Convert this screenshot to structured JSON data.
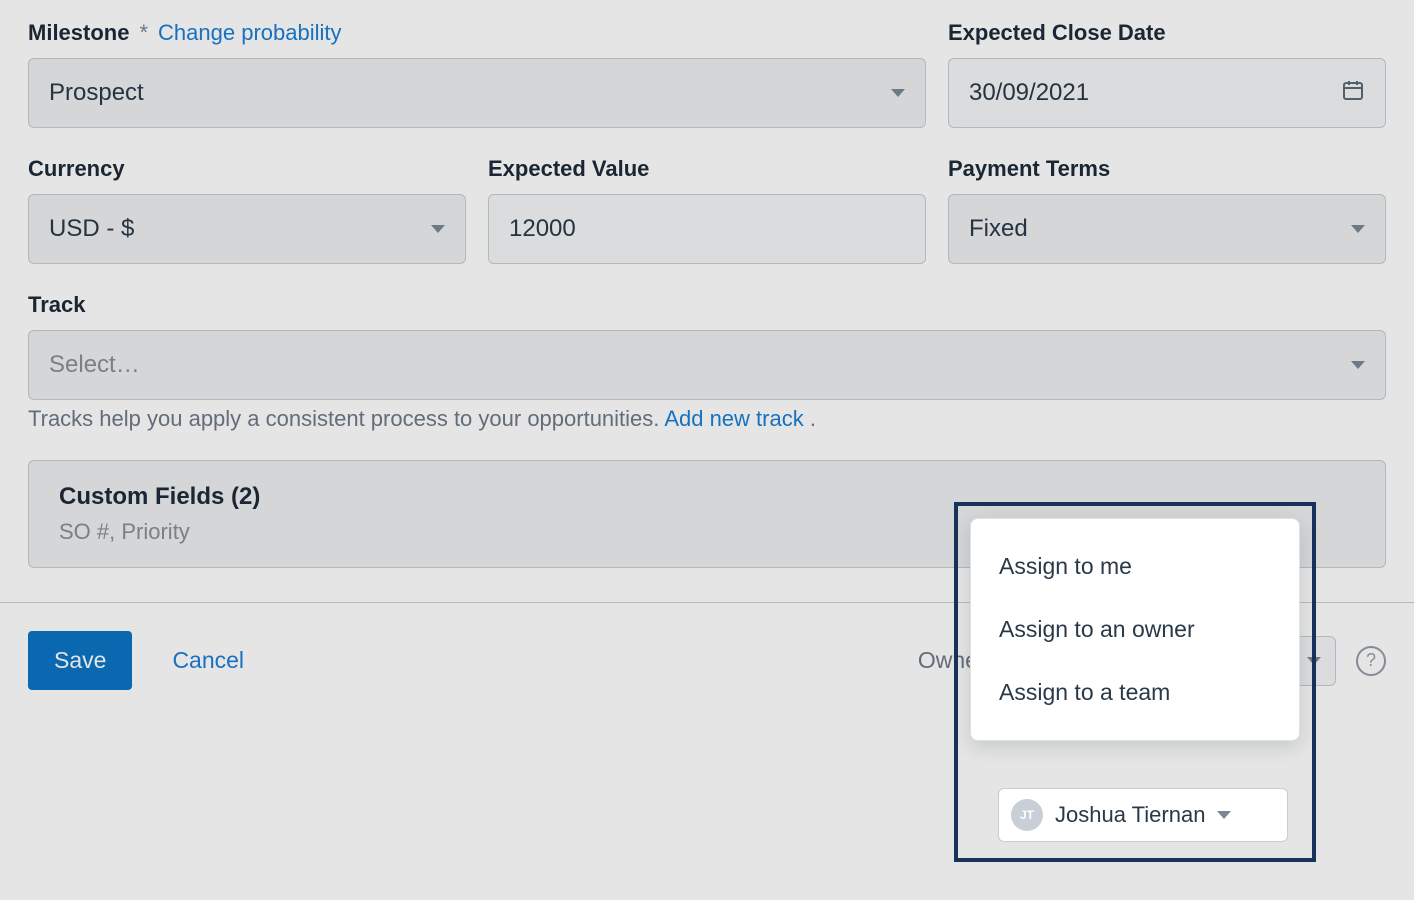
{
  "fields": {
    "milestone": {
      "label": "Milestone",
      "required_mark": "*",
      "change_link": "Change probability",
      "value": "Prospect"
    },
    "close_date": {
      "label": "Expected Close Date",
      "value": "30/09/2021"
    },
    "currency": {
      "label": "Currency",
      "value": "USD - $"
    },
    "expected_value": {
      "label": "Expected Value",
      "value": "12000"
    },
    "payment_terms": {
      "label": "Payment Terms",
      "value": "Fixed"
    },
    "track": {
      "label": "Track",
      "placeholder": "Select…"
    }
  },
  "track_helper": {
    "text": "Tracks help you apply a consistent process to your opportunities. ",
    "link": "Add new track",
    "suffix": " ."
  },
  "custom_fields": {
    "title": "Custom Fields (2)",
    "sub": "SO #, Priority"
  },
  "footer": {
    "save": "Save",
    "cancel": "Cancel",
    "owner_label": "Owner & Team",
    "owner_name": "Joshua Tiernan",
    "owner_initials": "JT",
    "help": "?"
  },
  "assign_menu": {
    "items": [
      "Assign to me",
      "Assign to an owner",
      "Assign to a team"
    ],
    "owner_name": "Joshua Tiernan",
    "owner_initials": "JT"
  }
}
